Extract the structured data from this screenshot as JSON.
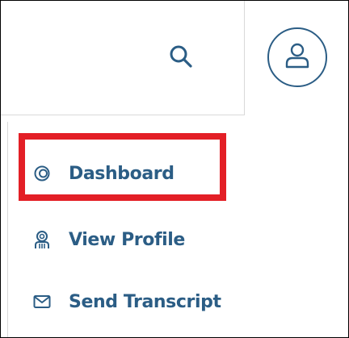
{
  "colors": {
    "accent": "#2b5d85",
    "highlight": "#e31f26"
  },
  "header": {
    "search_icon": "search-icon",
    "avatar_icon": "user-icon"
  },
  "menu": {
    "items": [
      {
        "label": "Dashboard",
        "icon": "dashboard-icon",
        "highlighted": true
      },
      {
        "label": "View Profile",
        "icon": "profile-icon",
        "highlighted": false
      },
      {
        "label": "Send Transcript",
        "icon": "envelope-icon",
        "highlighted": false
      }
    ]
  }
}
